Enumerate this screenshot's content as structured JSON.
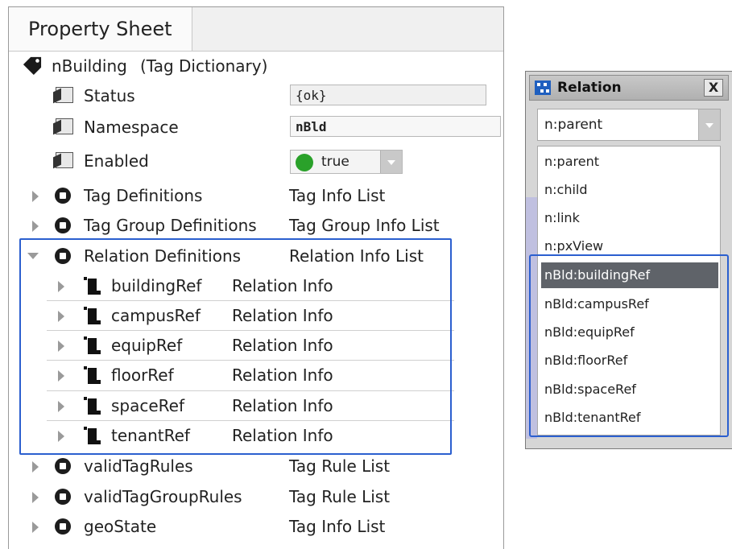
{
  "property_sheet": {
    "tab_label": "Property Sheet",
    "root": {
      "name": "nBuilding",
      "type": "(Tag Dictionary)"
    },
    "props": {
      "status": {
        "name": "Status",
        "value": "{ok}"
      },
      "namespace": {
        "name": "Namespace",
        "value": "nBld"
      },
      "enabled": {
        "name": "Enabled",
        "value": "true"
      }
    },
    "rows": [
      {
        "name": "Tag Definitions",
        "value": "Tag Info List"
      },
      {
        "name": "Tag Group Definitions",
        "value": "Tag Group Info List"
      },
      {
        "name": "Relation Definitions",
        "value": "Relation Info List"
      }
    ],
    "relations": [
      {
        "name": "buildingRef",
        "value": "Relation Info"
      },
      {
        "name": "campusRef",
        "value": "Relation Info"
      },
      {
        "name": "equipRef",
        "value": "Relation Info"
      },
      {
        "name": "floorRef",
        "value": "Relation Info"
      },
      {
        "name": "spaceRef",
        "value": "Relation Info"
      },
      {
        "name": "tenantRef",
        "value": "Relation Info"
      }
    ],
    "tail_rows": [
      {
        "name": "validTagRules",
        "value": "Tag Rule List"
      },
      {
        "name": "validTagGroupRules",
        "value": "Tag Rule List"
      },
      {
        "name": "geoState",
        "value": "Tag Info List"
      }
    ]
  },
  "relation_dialog": {
    "title": "Relation",
    "close_label": "X",
    "combo_value": "n:parent",
    "options": [
      "n:parent",
      "n:child",
      "n:link",
      "n:pxView",
      "nBld:buildingRef",
      "nBld:campusRef",
      "nBld:equipRef",
      "nBld:floorRef",
      "nBld:spaceRef",
      "nBld:tenantRef"
    ],
    "selected_option": "nBld:buildingRef"
  },
  "colors": {
    "highlight": "#2b5fcf",
    "selected_row": "#5f6369",
    "enabled_dot": "#2aa12a"
  }
}
